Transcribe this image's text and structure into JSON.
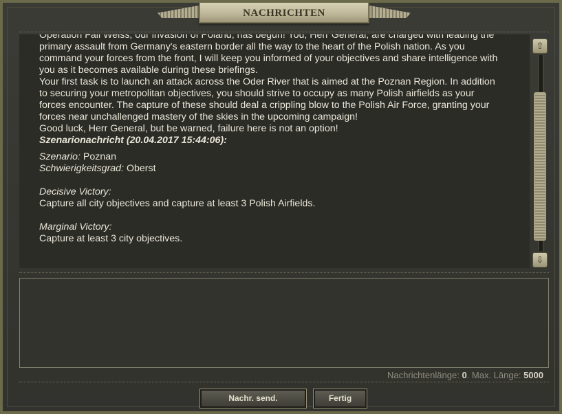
{
  "window": {
    "title": "NACHRICHTEN"
  },
  "message": {
    "intro_lines": [
      "Operation Fall Weiss, our invasion of Poland, has begun!  You, Herr General, are charged with leading the",
      "primary assault from Germany's eastern border all the way to the heart of the Polish nation.  As you",
      "command your forces from the front, I will keep you informed of your objectives and share intelligence with",
      "you as it becomes available during these briefings.",
      "Your first task is to launch an attack across the Oder River that is aimed at the Poznan Region.  In addition",
      "to securing your metropolitan objectives, you should strive to occupy as many Polish airfields as your",
      "forces encounter.  The capture of these should deal a crippling blow to the Polish Air Force, granting your",
      "forces near unchallenged mastery of the skies in the upcoming campaign!",
      "Good luck, Herr General, but be warned, failure here is not an option!"
    ],
    "scenario_header": "Szenarionachricht (20.04.2017 15:44:06):",
    "scenario_label": "Szenario:",
    "scenario_value": "Poznan",
    "difficulty_label": "Schwierigkeitsgrad:",
    "difficulty_value": "Oberst",
    "decisive_label": "Decisive Victory:",
    "decisive_text": "Capture all city objectives and capture at least 3 Polish Airfields.",
    "marginal_label": "Marginal Victory:",
    "marginal_text": "Capture at least 3 city objectives."
  },
  "scrollbar": {
    "up_icon": "arrow-up-icon",
    "down_icon": "arrow-down-icon"
  },
  "compose": {
    "value": ""
  },
  "counter": {
    "length_label": "Nachrichtenlänge:",
    "length_value": "0",
    "max_label": ". Max. Länge:",
    "max_value": "5000"
  },
  "buttons": {
    "send_label": "Nachr. send.",
    "done_label": "Fertig"
  }
}
